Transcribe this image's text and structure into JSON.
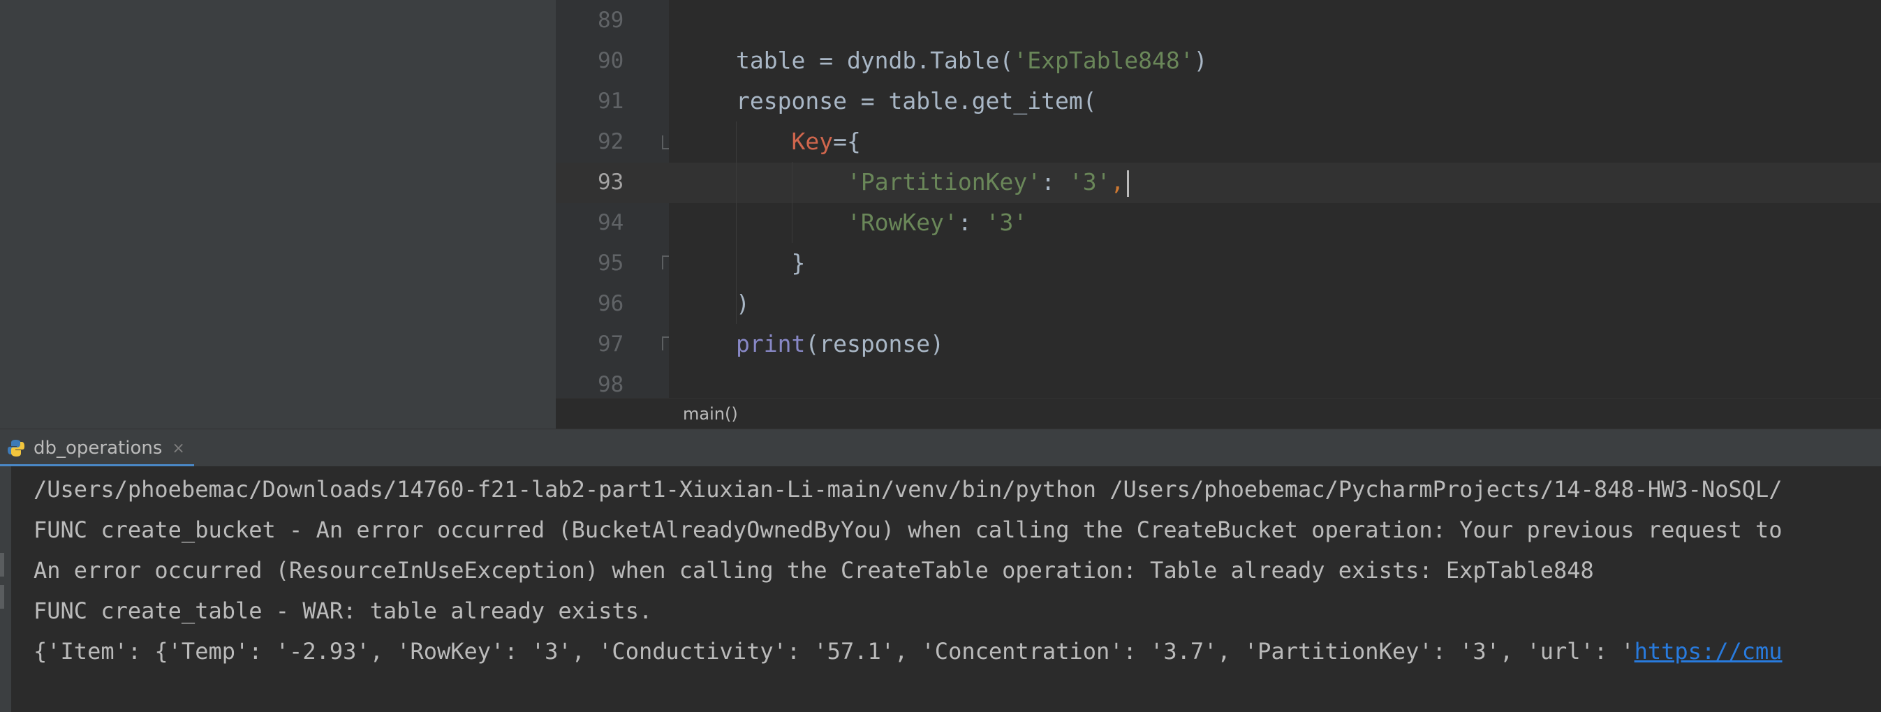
{
  "editor": {
    "line_numbers": [
      "89",
      "90",
      "91",
      "92",
      "93",
      "94",
      "95",
      "96",
      "97",
      "98"
    ],
    "current_line": "93",
    "lines": {
      "l90": {
        "a": "table = dyndb.Table(",
        "b": "'ExpTable848'",
        "c": ")"
      },
      "l91": {
        "a": "response = table.get_item("
      },
      "l92": {
        "a": "    ",
        "b": "Key",
        "c": "={"
      },
      "l93": {
        "a": "        ",
        "b": "'PartitionKey'",
        "c": ": ",
        "d": "'3'",
        "e": ","
      },
      "l94": {
        "a": "        ",
        "b": "'RowKey'",
        "c": ": ",
        "d": "'3'"
      },
      "l95": {
        "a": "    }"
      },
      "l96": {
        "a": ")"
      },
      "l97": {
        "a": "print",
        "b": "(response)"
      }
    },
    "icons": {
      "lightbulb": "lightbulb-icon",
      "fold": "fold-marker-icon"
    }
  },
  "breadcrumb": {
    "label": "main()"
  },
  "run_panel": {
    "tab_label": "db_operations",
    "tab_close": "×",
    "tab_icon": "python-icon"
  },
  "console": {
    "lines": [
      "/Users/phoebemac/Downloads/14760-f21-lab2-part1-Xiuxian-Li-main/venv/bin/python /Users/phoebemac/PycharmProjects/14-848-HW3-NoSQL/",
      "FUNC create_bucket - An error occurred (BucketAlreadyOwnedByYou) when calling the CreateBucket operation: Your previous request to",
      "An error occurred (ResourceInUseException) when calling the CreateTable operation: Table already exists: ExpTable848",
      "FUNC create_table - WAR: table already exists."
    ],
    "last_line_prefix": "{'Item': {'Temp': '-2.93', 'RowKey': '3', 'Conductivity': '57.1', 'Concentration': '3.7', 'PartitionKey': '3', 'url': '",
    "last_line_link": "https://cmu"
  },
  "colors": {
    "background": "#2b2b2b",
    "panel": "#3c3f41",
    "string": "#6a8759",
    "keyword": "#cc7832",
    "param": "#d0664d",
    "builtin": "#8888c6",
    "link": "#287bde",
    "accent": "#4a88c7"
  }
}
